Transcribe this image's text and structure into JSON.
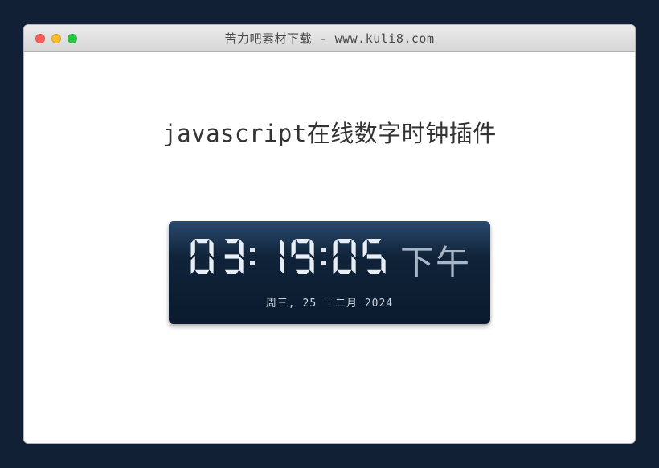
{
  "window": {
    "title": "苦力吧素材下载 - www.kuli8.com"
  },
  "page": {
    "heading": "javascript在线数字时钟插件"
  },
  "clock": {
    "time": "03:19:05",
    "ampm": "下午",
    "date": "周三, 25 十二月 2024"
  }
}
